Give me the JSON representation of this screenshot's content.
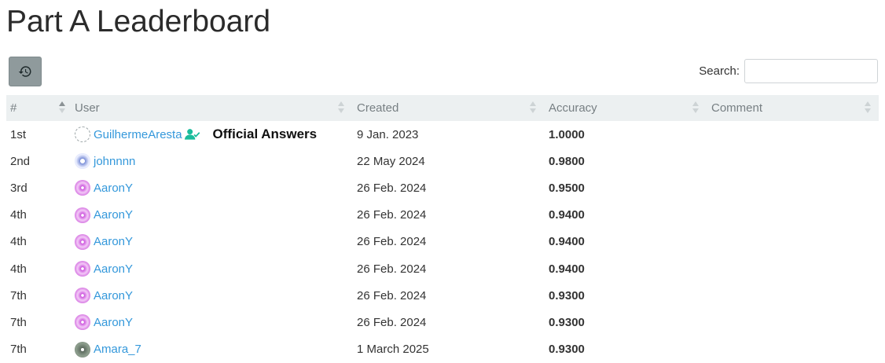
{
  "page": {
    "title": "Part A Leaderboard"
  },
  "toolbar": {
    "history_icon": "history-icon",
    "search_label": "Search:",
    "search_value": "",
    "search_placeholder": ""
  },
  "colors": {
    "link": "#3498db",
    "header_bg": "#ecf0f1",
    "history_button_bg": "#8f9a9c"
  },
  "table": {
    "columns": [
      "#",
      "User",
      "Created",
      "Accuracy",
      "Comment"
    ],
    "sorted_column": "#",
    "rows": [
      {
        "rank": "1st",
        "user": "GuilhermeAresta",
        "avatar": "avatar-dashed",
        "verified": true,
        "note": "Official Answers",
        "created": "9 Jan. 2023",
        "accuracy": "1.0000",
        "comment": ""
      },
      {
        "rank": "2nd",
        "user": "johnnnn",
        "avatar": "avatar-blue",
        "verified": false,
        "note": "",
        "created": "22 May 2024",
        "accuracy": "0.9800",
        "comment": ""
      },
      {
        "rank": "3rd",
        "user": "AaronY",
        "avatar": "avatar-pink",
        "verified": false,
        "note": "",
        "created": "26 Feb. 2024",
        "accuracy": "0.9500",
        "comment": ""
      },
      {
        "rank": "4th",
        "user": "AaronY",
        "avatar": "avatar-pink",
        "verified": false,
        "note": "",
        "created": "26 Feb. 2024",
        "accuracy": "0.9400",
        "comment": ""
      },
      {
        "rank": "4th",
        "user": "AaronY",
        "avatar": "avatar-pink",
        "verified": false,
        "note": "",
        "created": "26 Feb. 2024",
        "accuracy": "0.9400",
        "comment": ""
      },
      {
        "rank": "4th",
        "user": "AaronY",
        "avatar": "avatar-pink",
        "verified": false,
        "note": "",
        "created": "26 Feb. 2024",
        "accuracy": "0.9400",
        "comment": ""
      },
      {
        "rank": "7th",
        "user": "AaronY",
        "avatar": "avatar-pink",
        "verified": false,
        "note": "",
        "created": "26 Feb. 2024",
        "accuracy": "0.9300",
        "comment": ""
      },
      {
        "rank": "7th",
        "user": "AaronY",
        "avatar": "avatar-pink",
        "verified": false,
        "note": "",
        "created": "26 Feb. 2024",
        "accuracy": "0.9300",
        "comment": ""
      },
      {
        "rank": "7th",
        "user": "Amara_7",
        "avatar": "avatar-dark",
        "verified": false,
        "note": "",
        "created": "1 March 2025",
        "accuracy": "0.9300",
        "comment": ""
      }
    ]
  }
}
